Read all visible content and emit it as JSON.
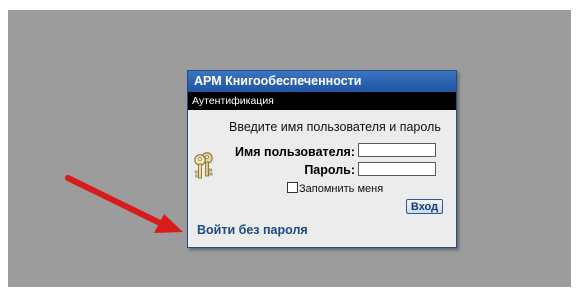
{
  "dialog": {
    "title": "АРМ Книгообеспеченности",
    "section_title": "Аутентификация",
    "instruction": "Введите имя пользователя и пароль",
    "username_label": "Имя пользователя:",
    "username_value": "",
    "password_label": "Пароль:",
    "password_value": "",
    "remember_label": "Запомнить меня",
    "remember_checked": false,
    "login_button": "Вход",
    "no_password_link": "Войти без пароля",
    "icon": "keys-icon"
  },
  "annotation": {
    "icon": "red-arrow-icon",
    "color": "#d81b1b"
  },
  "colors": {
    "backdrop": "#9c9c9c",
    "titlebar": "#2a62b0",
    "section_bar": "#000000",
    "dialog_body": "#ececec",
    "link": "#1a4b83"
  }
}
